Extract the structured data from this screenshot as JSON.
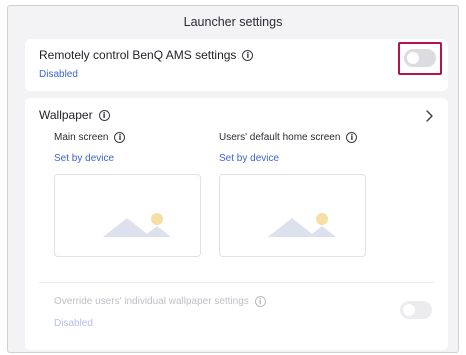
{
  "header": {
    "title": "Launcher settings"
  },
  "remote_control": {
    "label": "Remotely control BenQ AMS settings",
    "status": "Disabled",
    "enabled": false,
    "info_icon": "info-icon"
  },
  "wallpaper": {
    "label": "Wallpaper",
    "info_icon": "info-icon",
    "chevron_icon": "chevron-right-icon",
    "main_screen": {
      "label": "Main screen",
      "value": "Set by device",
      "preview_icon": "image-placeholder-icon"
    },
    "users_default": {
      "label": "Users' default home screen",
      "value": "Set by device",
      "preview_icon": "image-placeholder-icon"
    },
    "override": {
      "label": "Override users' individual wallpaper settings",
      "status": "Disabled",
      "enabled": false,
      "disabled_control": true
    }
  },
  "colors": {
    "accent_link": "#3d63d9",
    "highlight_border": "#b3124a",
    "mountain": "#dde1ee",
    "sun": "#f5dfa2"
  }
}
